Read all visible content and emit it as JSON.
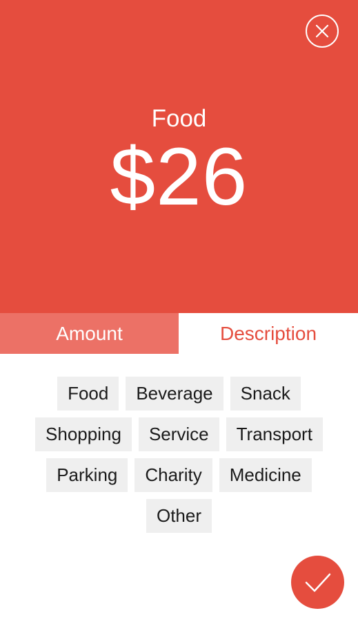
{
  "colors": {
    "accent": "#e54d3e",
    "tab_active_bg": "#ec7166",
    "chip_bg": "#efefef"
  },
  "header": {
    "close_icon": "close-icon",
    "category": "Food",
    "amount": "$26"
  },
  "tabs": [
    {
      "label": "Amount",
      "active": true
    },
    {
      "label": "Description",
      "active": false
    }
  ],
  "categories": {
    "rows": [
      [
        "Food",
        "Beverage",
        "Snack"
      ],
      [
        "Shopping",
        "Service",
        "Transport"
      ],
      [
        "Parking",
        "Charity",
        "Medicine"
      ],
      [
        "Other"
      ]
    ]
  },
  "confirm": {
    "icon": "checkmark-icon"
  }
}
